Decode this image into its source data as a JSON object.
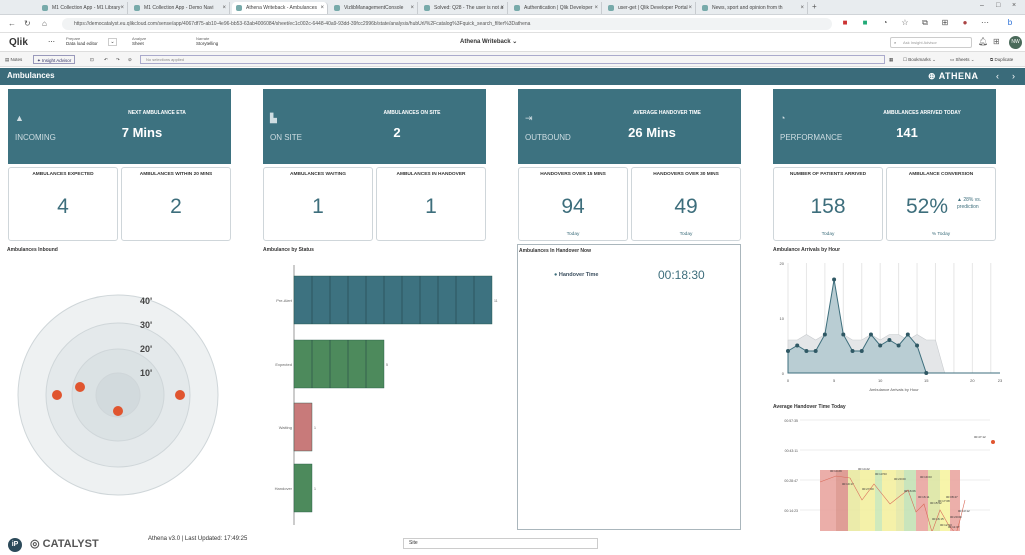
{
  "browser": {
    "tabs": [
      {
        "label": "M1 Collection App - M1 Library"
      },
      {
        "label": "M1 Collection App - Demo Navi"
      },
      {
        "label": "Athena Writeback - Ambulances"
      },
      {
        "label": "VizlibManagementConsole"
      },
      {
        "label": "Solved: Q28 - The user is not a"
      },
      {
        "label": "Authentication | Qlik Developer"
      },
      {
        "label": "user-get | Qlik Developer Portal"
      },
      {
        "label": "News, sport and opinion from th"
      }
    ],
    "url": "https://democatalyst.eu.qlikcloud.com/sense/app/4067df75-ab10-4e96-bb53-63ab4006084/sheet/ec1c002c-6448-40a9-93dd-39fcc2996b/state/analysis/hubUrl/%2Fcatalog%3Fquick_search_filter%3Dathena"
  },
  "qlik": {
    "logo": "Qlik",
    "modes": [
      {
        "top": "Prepare",
        "bottom": "Data load editor"
      },
      {
        "top": "Analyze",
        "bottom": "Sheet"
      },
      {
        "top": "Narrate",
        "bottom": "Storytelling"
      }
    ],
    "app_title": "Athena Writeback",
    "search_placeholder": "Ask Insight Advisor",
    "avatar": "NW",
    "notes": "Notes",
    "insight": "Insight Advisor",
    "selections": "No selections applied",
    "bookmarks": "Bookmarks",
    "sheets": "Sheets",
    "duplicate": "Duplicate"
  },
  "sheet": {
    "title": "Ambulances",
    "brand": "ATHENA"
  },
  "kpis": [
    {
      "label": "INCOMING",
      "caption": "NEXT AMBULANCE ETA",
      "value": "7 Mins"
    },
    {
      "label": "ON SITE",
      "caption": "AMBULANCES ON SITE",
      "value": "2"
    },
    {
      "label": "OUTBOUND",
      "caption": "AVERAGE HANDOVER TIME",
      "value": "26 Mins"
    },
    {
      "label": "PERFORMANCE",
      "caption": "AMBULANCES ARRIVED TODAY",
      "value": "141"
    }
  ],
  "cards": [
    {
      "title": "AMBULANCES EXPECTED",
      "value": "4",
      "foot": ""
    },
    {
      "title": "AMBULANCES WITHIN 20 MINS",
      "value": "2",
      "foot": ""
    },
    {
      "title": "AMBULANCES WAITING",
      "value": "1",
      "foot": ""
    },
    {
      "title": "AMBULANCES IN HANDOVER",
      "value": "1",
      "foot": ""
    },
    {
      "title": "HANDOVERS OVER 15 MINS",
      "value": "94",
      "foot": "Today"
    },
    {
      "title": "HANDOVERS OVER 30 MINS",
      "value": "49",
      "foot": "Today"
    },
    {
      "title": "NUMBER OF PATIENTS ARRIVED",
      "value": "158",
      "foot": "Today"
    },
    {
      "title": "AMBULANCE CONVERSION",
      "value": "52%",
      "foot": "% Today",
      "note": "▲ 28% vs. prediction"
    }
  ],
  "panels": {
    "inbound": "Ambulances Inbound",
    "status": "Ambulance by Status",
    "handover": "Ambulances In Handover Now",
    "arrivals": "Ambulance Arrivals by Hour",
    "avgtime": "Average Handover Time Today"
  },
  "handover_row": {
    "label": "Handover Time",
    "value": "00:18:30"
  },
  "footer": {
    "brand": "CATALYST",
    "version": "Athena v3.0 | Last Updated: 17:49:25",
    "site": "Site"
  },
  "colors": {
    "teal": "#3d7280",
    "dark": "#3a6b7a",
    "green": "#4d8a5c",
    "red": "#c87a7a",
    "dot": "#e0552f"
  },
  "chart_data": [
    {
      "type": "scatter",
      "title": "Ambulances Inbound",
      "polar": true,
      "ring_labels": [
        "40'",
        "30'",
        "20'",
        "10'"
      ],
      "points": [
        {
          "r": 20,
          "angle": 270
        },
        {
          "r": 20,
          "angle": 90
        },
        {
          "r": 12,
          "angle": 225
        },
        {
          "r": 8,
          "angle": 180
        }
      ]
    },
    {
      "type": "bar",
      "orientation": "horizontal",
      "title": "Ambulance by Status",
      "categories": [
        "Pre-Alert",
        "Expected",
        "Waiting",
        "Handover"
      ],
      "values": [
        11,
        5,
        1,
        1
      ]
    },
    {
      "type": "area",
      "title": "Ambulance Arrivals by Hour",
      "xlabel": "Ambulance Arrivals by Hour",
      "x": [
        0,
        1,
        2,
        3,
        4,
        5,
        6,
        7,
        8,
        9,
        10,
        11,
        12,
        13,
        14,
        15,
        16,
        17,
        18,
        19,
        20,
        21,
        22,
        23
      ],
      "ylim": [
        0,
        20
      ],
      "x_ticks": [
        "0",
        "5",
        "10",
        "15",
        "20",
        "23"
      ],
      "y_ticks": [
        "20",
        "10",
        "0"
      ],
      "series": [
        {
          "values": [
            6,
            6,
            7,
            6,
            7,
            6,
            7,
            6,
            6,
            7,
            6,
            7,
            7,
            6,
            7,
            6,
            6,
            0,
            0,
            0,
            0,
            0,
            0,
            0
          ]
        },
        {
          "values": [
            4,
            5,
            4,
            4,
            7,
            17,
            7,
            4,
            4,
            7,
            5,
            6,
            5,
            7,
            5,
            0,
            0,
            0,
            0,
            0,
            0,
            0,
            0,
            0
          ]
        }
      ]
    },
    {
      "type": "bar",
      "title": "Average Handover Time Today",
      "y_ticks": [
        "00:57:35",
        "00:43:11",
        "00:28:47",
        "00:14:23",
        "00:00:00"
      ],
      "x_ticks": [
        "0",
        "5",
        "10",
        "15",
        "20"
      ],
      "labels": [
        "00:14:29",
        "00:19:17",
        "00:14:22",
        "00:27:00",
        "00:13:53",
        "00:20:00",
        "00:16:06",
        "00:19:03",
        "00:16:11",
        "00:15:52",
        "00:17:08",
        "00:08:47",
        "00:20:00",
        "00:16:15",
        "00:12:03",
        "00:11:37",
        "00:13:12",
        "00:47:12"
      ]
    }
  ]
}
